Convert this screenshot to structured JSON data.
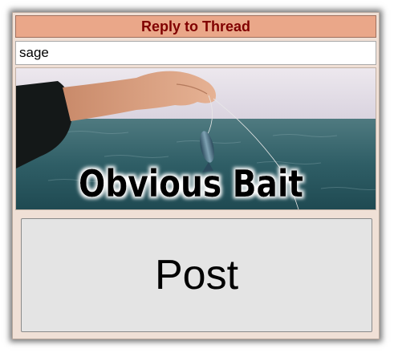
{
  "dialog": {
    "title": "Reply to Thread",
    "name_field": {
      "value": "sage",
      "placeholder": ""
    },
    "image": {
      "caption": "Obvious Bait",
      "alt": "Obvious Bait"
    },
    "post_button_label": "Post"
  },
  "colors": {
    "panel_bg": "#f0e0d6",
    "title_bg": "#eaa789",
    "title_text": "#800000",
    "button_bg": "#e4e4e4"
  }
}
